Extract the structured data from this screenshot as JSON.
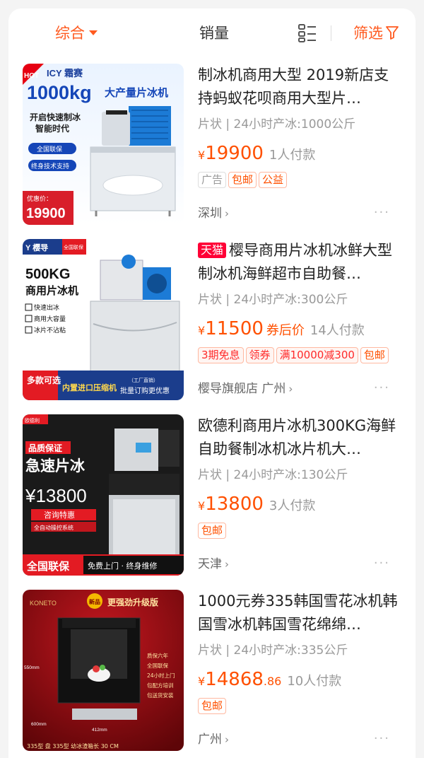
{
  "filter": {
    "sort_label": "综合",
    "sales_label": "销量",
    "filter_label": "筛选"
  },
  "products": [
    {
      "title": "制冰机商用大型 2019新店支持蚂蚁花呗商用大型片…",
      "spec": "片状 | 24小时产冰:1000公斤",
      "price": "19900",
      "buyers": "1人付款",
      "tags": [
        "广告",
        "包邮",
        "公益"
      ],
      "location": "深圳",
      "thumb": {
        "brand": "ICY 霜赛",
        "badge": "HOT",
        "headline": "1000kg",
        "headline2": "大产量片冰机",
        "slogan1": "开启快速制冰",
        "slogan2": "智能时代",
        "pill1": "全国联保",
        "pill2": "终身技术支持",
        "promo_label": "优惠价：",
        "promo_price": "19900"
      }
    },
    {
      "tmall": "天猫",
      "title": "樱导商用片冰机冰鲜大型制冰机海鲜超市自助餐…",
      "spec": "片状 | 24小时产冰:300公斤",
      "price": "11500",
      "after_coupon": "券后价",
      "buyers": "14人付款",
      "tags": [
        "3期免息",
        "领券",
        "满10000减300",
        "包邮"
      ],
      "location": "樱导旗舰店 广州",
      "thumb": {
        "brand": "Y 樱导",
        "corner": "全国联保",
        "headline": "500KG",
        "headline2": "商用片冰机",
        "checks": [
          "快速出冰",
          "商用大容量",
          "冰片不沾粘"
        ],
        "bottom_left": "多款可选",
        "bottom_mid": "内置进口压缩机",
        "bottom_right_small": "（工厂直销）",
        "bottom_right": "批量订购更优惠"
      }
    },
    {
      "title": "欧德利商用片冰机300KG海鲜自助餐制冰机冰片机大…",
      "spec": "片状 | 24小时产冰:130公斤",
      "price": "13800",
      "buyers": "3人付款",
      "tags": [
        "包邮"
      ],
      "location": "天津",
      "thumb": {
        "corner": "欧德利",
        "tag1": "品质保证",
        "headline": "急速片冰",
        "price": "¥13800",
        "btn": "咨询特惠",
        "sub": "全自动操控系统",
        "bottom_left": "全国联保",
        "bottom_right": "免费上门 · 终身维修"
      }
    },
    {
      "title": "1000元券335韩国雪花冰机韩国雪冰机韩国雪花绵绵…",
      "spec": "片状 | 24小时产冰:335公斤",
      "price": "14868",
      "price_dec": ".86",
      "buyers": "10人付款",
      "tags": [
        "包邮"
      ],
      "location": "广州",
      "thumb": {
        "brand": "KONETO",
        "new": "新品",
        "headline": "更强劲升级版",
        "dim_h": "550mm",
        "dim_d": "600mm",
        "dim_w": "412mm",
        "features": [
          "质保六年",
          "全国联保",
          "24小时上门",
          "包配方培训",
          "包送货安装"
        ],
        "bottom": "335型 盘 335型  幼冰渣箱长 30 CM"
      }
    }
  ],
  "colors": {
    "accent": "#ff5a1f",
    "price": "#ff5000",
    "tmall": "#ff0036"
  }
}
